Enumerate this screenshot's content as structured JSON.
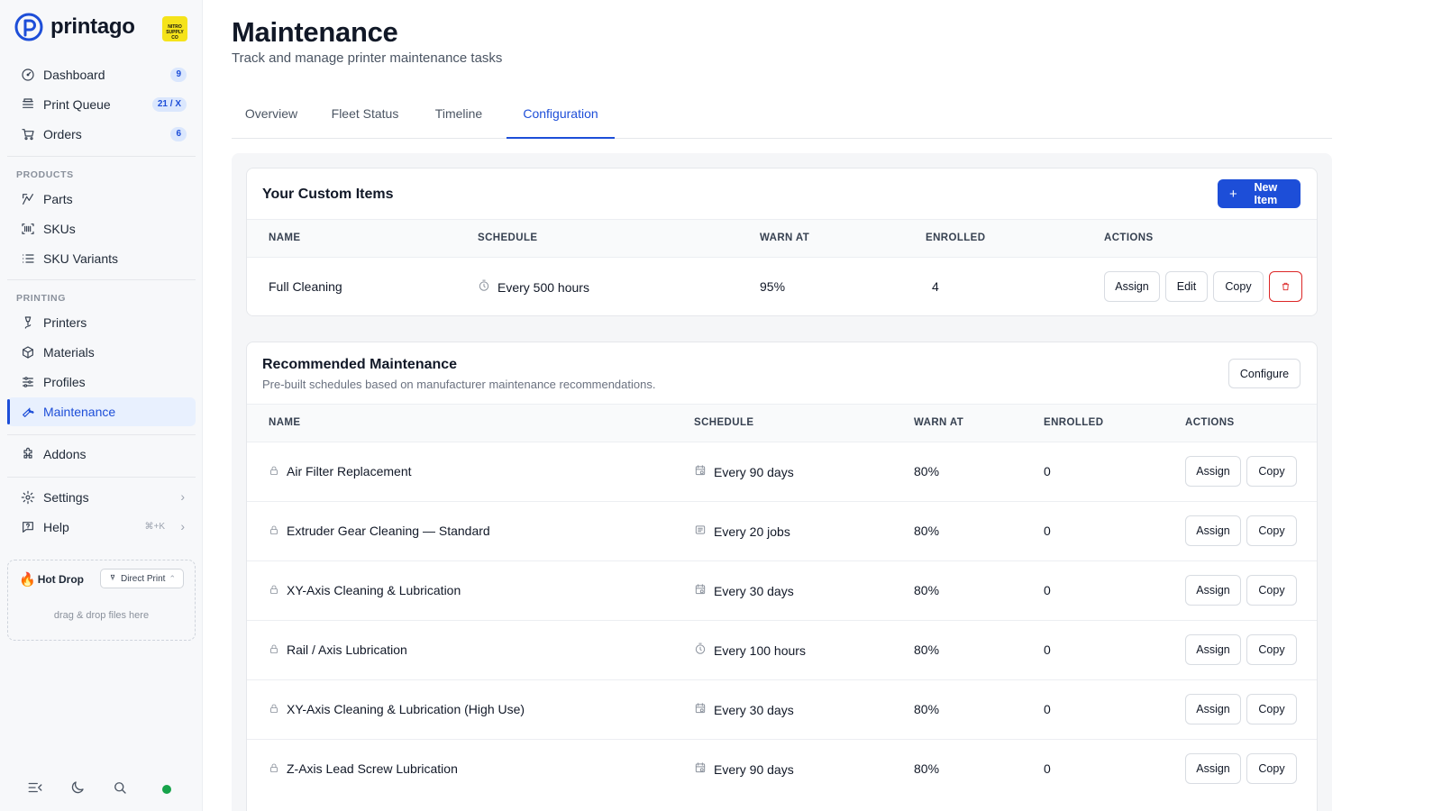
{
  "app": {
    "brand": "printago",
    "org_badge": "NITRO SUPPLY CO"
  },
  "sidebar": {
    "nav_top": [
      {
        "label": "Dashboard",
        "icon": "dashboard-icon",
        "count": "9"
      },
      {
        "label": "Print Queue",
        "icon": "queue-icon",
        "count": "21 / X"
      },
      {
        "label": "Orders",
        "icon": "cart-icon",
        "count": "6"
      }
    ],
    "products_label": "PRODUCTS",
    "products": [
      {
        "label": "Parts",
        "icon": "parts-icon"
      },
      {
        "label": "SKUs",
        "icon": "barcode-icon"
      },
      {
        "label": "SKU Variants",
        "icon": "list-icon"
      }
    ],
    "printing_label": "PRINTING",
    "printing": [
      {
        "label": "Printers",
        "icon": "printer-icon"
      },
      {
        "label": "Materials",
        "icon": "cube-icon"
      },
      {
        "label": "Profiles",
        "icon": "sliders-icon"
      },
      {
        "label": "Maintenance",
        "icon": "wrench-icon",
        "active": true
      }
    ],
    "addons": {
      "label": "Addons",
      "icon": "puzzle-icon"
    },
    "settings": {
      "label": "Settings",
      "icon": "gear-icon"
    },
    "help": {
      "label": "Help",
      "icon": "help-icon",
      "shortcut": "⌘+K"
    },
    "hot_drop": {
      "title": "Hot Drop",
      "mode": "Direct Print",
      "hint": "drag & drop files here"
    },
    "footer_icons": [
      "collapse-icon",
      "moon-icon",
      "search-icon",
      "status-dot"
    ]
  },
  "page": {
    "title": "Maintenance",
    "subtitle": "Track and manage printer maintenance tasks",
    "tabs": [
      "Overview",
      "Fleet Status",
      "Timeline",
      "Configuration"
    ],
    "active_tab": "Configuration"
  },
  "custom_items": {
    "title": "Your Custom Items",
    "new_button": "New Item",
    "columns": [
      "NAME",
      "SCHEDULE",
      "WARN AT",
      "ENROLLED",
      "ACTIONS"
    ],
    "rows": [
      {
        "name": "Full Cleaning",
        "schedule_icon": "timer-icon",
        "schedule": "Every 500 hours",
        "warn_at": "95%",
        "enrolled": "4",
        "actions": [
          "Assign",
          "Edit",
          "Copy"
        ],
        "delete_icon": "trash-icon"
      }
    ]
  },
  "recommended": {
    "title": "Recommended Maintenance",
    "description": "Pre-built schedules based on manufacturer maintenance recommendations.",
    "configure_button": "Configure",
    "columns": [
      "NAME",
      "SCHEDULE",
      "WARN AT",
      "ENROLLED",
      "ACTIONS"
    ],
    "row_actions": [
      "Assign",
      "Copy"
    ],
    "rows": [
      {
        "name": "Air Filter Replacement",
        "schedule_icon": "calendar-icon",
        "schedule": "Every 90 days",
        "warn_at": "80%",
        "enrolled": "0"
      },
      {
        "name": "Extruder Gear Cleaning — Standard",
        "schedule_icon": "jobs-icon",
        "schedule": "Every 20 jobs",
        "warn_at": "80%",
        "enrolled": "0"
      },
      {
        "name": "XY-Axis Cleaning & Lubrication",
        "schedule_icon": "calendar-icon",
        "schedule": "Every 30 days",
        "warn_at": "80%",
        "enrolled": "0"
      },
      {
        "name": "Rail / Axis Lubrication",
        "schedule_icon": "timer-icon",
        "schedule": "Every 100 hours",
        "warn_at": "80%",
        "enrolled": "0"
      },
      {
        "name": "XY-Axis Cleaning & Lubrication (High Use)",
        "schedule_icon": "calendar-icon",
        "schedule": "Every 30 days",
        "warn_at": "80%",
        "enrolled": "0"
      },
      {
        "name": "Z-Axis Lead Screw Lubrication",
        "schedule_icon": "calendar-icon",
        "schedule": "Every 90 days",
        "warn_at": "80%",
        "enrolled": "0"
      }
    ]
  }
}
